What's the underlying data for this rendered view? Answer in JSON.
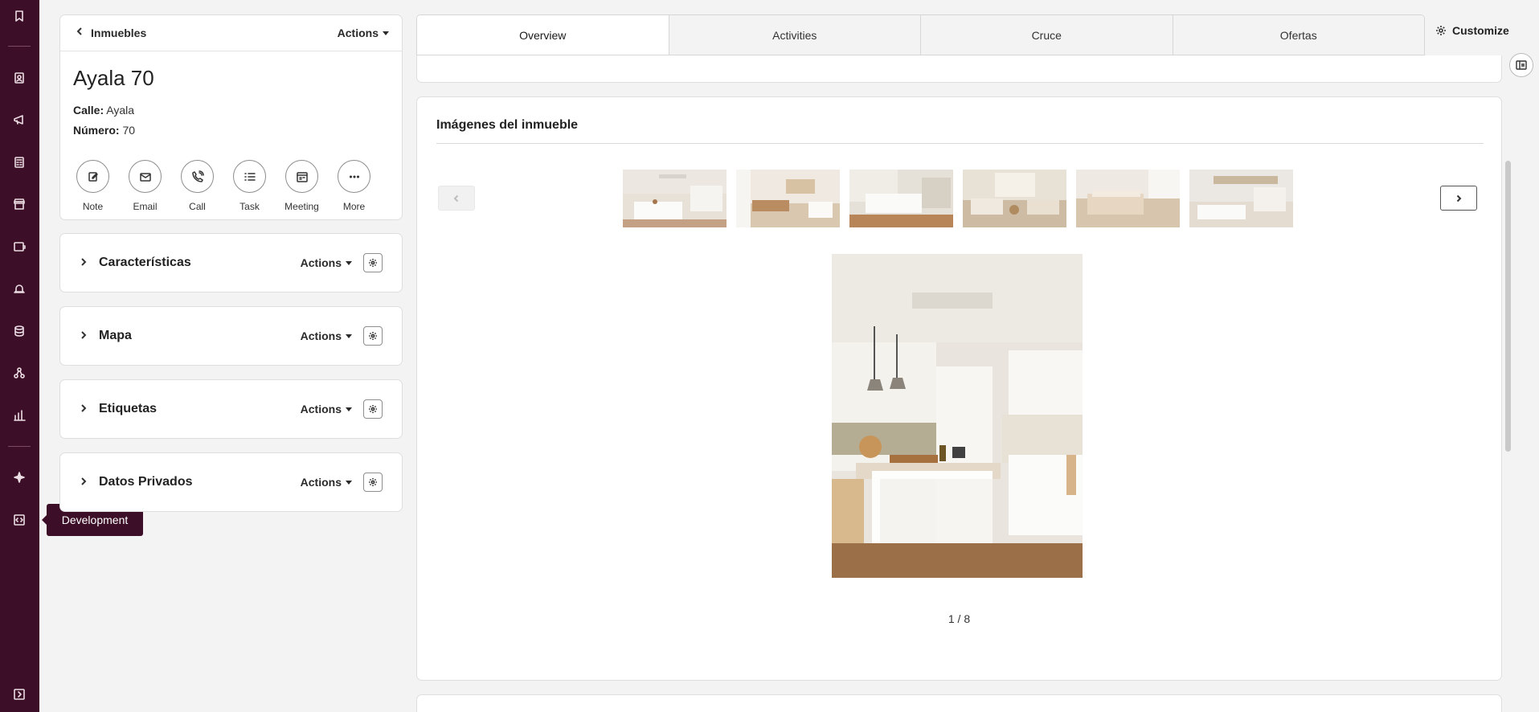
{
  "rail": {
    "items": [
      "bookmark-icon",
      "contacts-icon",
      "megaphone-icon",
      "calculator-icon",
      "store-icon",
      "wallet-icon",
      "bell-icon",
      "database-icon",
      "network-icon",
      "bar-chart-icon",
      "sparkle-icon",
      "code-icon",
      "expand-icon"
    ]
  },
  "tooltip": {
    "label": "Development"
  },
  "record": {
    "breadcrumb": "Inmuebles",
    "actions_label": "Actions",
    "title": "Ayala 70",
    "fields": [
      {
        "label": "Calle:",
        "value": "Ayala"
      },
      {
        "label": "Número:",
        "value": "70"
      }
    ],
    "quick_actions": [
      {
        "label": "Note",
        "icon": "note-icon"
      },
      {
        "label": "Email",
        "icon": "email-icon"
      },
      {
        "label": "Call",
        "icon": "call-icon"
      },
      {
        "label": "Task",
        "icon": "task-icon"
      },
      {
        "label": "Meeting",
        "icon": "meeting-icon"
      },
      {
        "label": "More",
        "icon": "more-icon"
      }
    ]
  },
  "sections": [
    {
      "title": "Características",
      "actions_label": "Actions"
    },
    {
      "title": "Mapa",
      "actions_label": "Actions"
    },
    {
      "title": "Etiquetas",
      "actions_label": "Actions"
    },
    {
      "title": "Datos Privados",
      "actions_label": "Actions"
    }
  ],
  "tabs": [
    {
      "label": "Overview",
      "active": true
    },
    {
      "label": "Activities",
      "active": false
    },
    {
      "label": "Cruce",
      "active": false
    },
    {
      "label": "Ofertas",
      "active": false
    }
  ],
  "customize_label": "Customize",
  "gallery": {
    "title": "Imágenes del inmueble",
    "counter": "1 / 8"
  }
}
